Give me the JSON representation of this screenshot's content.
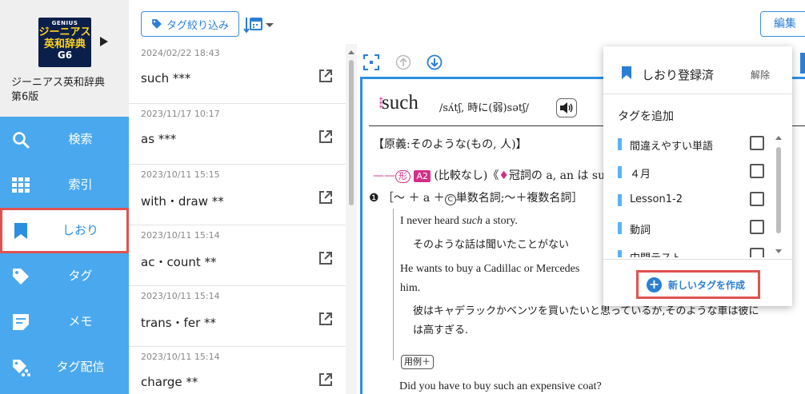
{
  "dictionary": {
    "cover_brand": "GENIUS",
    "cover_title_1": "ジーニアス",
    "cover_title_2": "英和辞典",
    "cover_edition": "G6",
    "title": "ジーニアス英和辞典\n第6版"
  },
  "nav": {
    "items": [
      {
        "label": "検索",
        "icon": "search-icon"
      },
      {
        "label": "索引",
        "icon": "grid-icon"
      },
      {
        "label": "しおり",
        "icon": "bookmark-icon",
        "active": true
      },
      {
        "label": "タグ",
        "icon": "tag-icon"
      },
      {
        "label": "メモ",
        "icon": "memo-icon"
      },
      {
        "label": "タグ配信",
        "icon": "tag-share-icon"
      }
    ]
  },
  "toolbar": {
    "tag_filter_label": "タグ絞り込み",
    "edit_label": "編集"
  },
  "history": {
    "entries": [
      {
        "date": "2024/02/22 18:43",
        "word": "such ***"
      },
      {
        "date": "2023/11/17 10:17",
        "word": "as ***"
      },
      {
        "date": "2023/10/11 15:15",
        "word": "with・draw **"
      },
      {
        "date": "2023/10/11 15:14",
        "word": "ac・count **"
      },
      {
        "date": "2023/10/11 15:14",
        "word": "trans・fer **"
      },
      {
        "date": "2023/10/11 15:14",
        "word": "charge **"
      }
    ]
  },
  "entry": {
    "headword_mark": "***",
    "headword": "such",
    "pronunciation": "/sʌ́tʃ, 時に(弱)sətʃ/",
    "origin": "【原義:そのような(もの, 人)】",
    "pos_dash": "——",
    "pos": "形",
    "level": "A2",
    "pos_note": "(比較なし)《",
    "pos_diamond": "♦",
    "pos_note_2": "冠詞の a, an は su",
    "sense_number": "❶",
    "sense_pre": "［～ ＋ a ＋",
    "sense_circle": "C",
    "sense_post": "単数名詞;～＋複数名詞］",
    "examples": [
      {
        "pre": "I never heard ",
        "em": "such",
        "post": " a story.",
        "ja": "そのような話は聞いたことがない"
      },
      {
        "pre": "He wants to buy a Cadillac or Mercedes",
        "em": "",
        "post": "",
        "ja": ""
      },
      {
        "pre": "him.",
        "em": "",
        "post": "",
        "ja": ""
      }
    ],
    "example_ja_2a": "彼はキャデラックかベンツを買いたいと思っているが,そのような車は彼に",
    "example_ja_2b": "は高すぎる.",
    "usage_label": "用例＋",
    "last_example": "Did you have to buy such an expensive coat?"
  },
  "popup": {
    "title": "しおり登録済",
    "clear_label": "解除",
    "add_tag_label": "タグを追加",
    "tags": [
      {
        "name": "間違えやすい単語",
        "checked": false
      },
      {
        "name": "４月",
        "checked": false
      },
      {
        "name": "Lesson1-2",
        "checked": false
      },
      {
        "name": "動詞",
        "checked": false
      },
      {
        "name": "中間テスト",
        "checked": false
      }
    ],
    "new_tag_label": "新しいタグを作成"
  },
  "colors": {
    "sidebar": "#4aa8ee",
    "accent": "#2a7fd4",
    "highlight": "#e0524f",
    "pos_pink": "#d0308a"
  }
}
